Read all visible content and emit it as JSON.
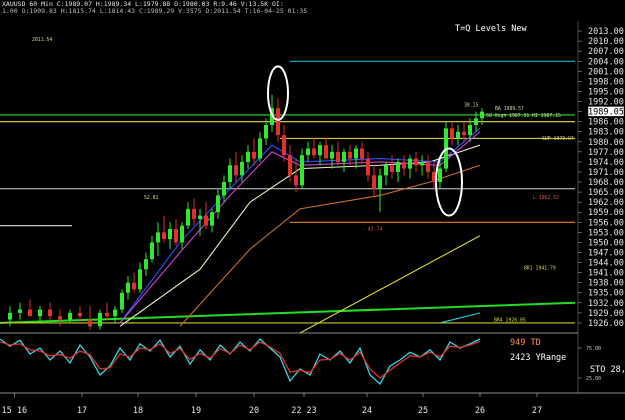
{
  "header": {
    "info_line1": "XAUUSD 60 Min  C:1989.07  H:1989.34  L:1979.88  O:1980.03  R:9.46  V:13.5K  OI:",
    "info_line2": "1.00  O:1909.83  H:1815.74  L:1814.43  C:1989.29  V:3575  D:2011.54  T:16-04-25 01:35",
    "stray_label": "2011.54"
  },
  "chart_data": [
    {
      "type": "candlestick",
      "title": "T=Q Levels New",
      "ylim": [
        1923,
        2016
      ],
      "y_ticks": [
        "2013.00",
        "2010.00",
        "2007.00",
        "2004.00",
        "2001.00",
        "1998.00",
        "1995.00",
        "1992.00",
        "1989.05",
        "1986.00",
        "1983.00",
        "1980.00",
        "1977.00",
        "1974.00",
        "1971.00",
        "1968.00",
        "1965.00",
        "1962.00",
        "1959.00",
        "1956.00",
        "1953.00",
        "1950.00",
        "1947.00",
        "1944.00",
        "1941.00",
        "1938.00",
        "1935.00",
        "1932.00",
        "1929.00",
        "1926.00"
      ],
      "last_price": "1989.05",
      "x_ticks": [
        {
          "label": "15 16",
          "x": 14.3
        },
        {
          "label": "17",
          "x": 82
        },
        {
          "label": "18",
          "x": 138
        },
        {
          "label": "19",
          "x": 196
        },
        {
          "label": "20",
          "x": 254
        },
        {
          "label": "22 23",
          "x": 304
        },
        {
          "label": "24",
          "x": 367
        },
        {
          "label": "25",
          "x": 423
        },
        {
          "label": "26",
          "x": 480
        },
        {
          "label": "27",
          "x": 537
        }
      ],
      "x_domain": [
        0,
        575
      ],
      "candles": [
        [
          10,
          1927,
          1931,
          1925,
          1929
        ],
        [
          20,
          1929,
          1932,
          1927,
          1930
        ],
        [
          30,
          1930,
          1933,
          1928,
          1928
        ],
        [
          40,
          1928,
          1931,
          1926,
          1930
        ],
        [
          50,
          1930,
          1932,
          1927,
          1928
        ],
        [
          60,
          1928,
          1930,
          1925,
          1927
        ],
        [
          70,
          1927,
          1930,
          1926,
          1929
        ],
        [
          80,
          1929,
          1931,
          1926,
          1928
        ],
        [
          90,
          1927,
          1931,
          1924,
          1925
        ],
        [
          100,
          1925,
          1930,
          1924,
          1929
        ],
        [
          107,
          1929,
          1932,
          1927,
          1928
        ],
        [
          115,
          1928,
          1931,
          1926,
          1930
        ],
        [
          122,
          1930,
          1936,
          1929,
          1935
        ],
        [
          128,
          1935,
          1940,
          1933,
          1938
        ],
        [
          134,
          1938,
          1941,
          1935,
          1936
        ],
        [
          140,
          1936,
          1944,
          1935,
          1942
        ],
        [
          146,
          1942,
          1947,
          1940,
          1945
        ],
        [
          152,
          1945,
          1952,
          1944,
          1950
        ],
        [
          158,
          1950,
          1956,
          1946,
          1953
        ],
        [
          164,
          1953,
          1958,
          1950,
          1951
        ],
        [
          170,
          1951,
          1956,
          1948,
          1954
        ],
        [
          176,
          1954,
          1957,
          1949,
          1950
        ],
        [
          182,
          1950,
          1956,
          1948,
          1955
        ],
        [
          188,
          1955,
          1962,
          1954,
          1960
        ],
        [
          194,
          1960,
          1963,
          1955,
          1957
        ],
        [
          200,
          1957,
          1960,
          1952,
          1958
        ],
        [
          206,
          1958,
          1962,
          1954,
          1955
        ],
        [
          212,
          1955,
          1960,
          1953,
          1959
        ],
        [
          218,
          1959,
          1966,
          1957,
          1964
        ],
        [
          224,
          1964,
          1970,
          1962,
          1968
        ],
        [
          230,
          1968,
          1975,
          1966,
          1973
        ],
        [
          236,
          1973,
          1977,
          1968,
          1970
        ],
        [
          242,
          1970,
          1976,
          1968,
          1974
        ],
        [
          248,
          1974,
          1979,
          1972,
          1977
        ],
        [
          254,
          1977,
          1981,
          1973,
          1975
        ],
        [
          260,
          1975,
          1983,
          1974,
          1981
        ],
        [
          266,
          1981,
          1987,
          1979,
          1985
        ],
        [
          272,
          1985,
          1994,
          1983,
          1990
        ],
        [
          278,
          1990,
          1993,
          1980,
          1982
        ],
        [
          284,
          1982,
          1985,
          1974,
          1976
        ],
        [
          290,
          1976,
          1979,
          1968,
          1970
        ],
        [
          296,
          1970,
          1975,
          1965,
          1967
        ],
        [
          302,
          1967,
          1978,
          1966,
          1976
        ],
        [
          308,
          1976,
          1980,
          1974,
          1978
        ],
        [
          314,
          1978,
          1981,
          1975,
          1976
        ],
        [
          320,
          1976,
          1980,
          1973,
          1979
        ],
        [
          326,
          1979,
          1981,
          1975,
          1975
        ],
        [
          332,
          1975,
          1979,
          1972,
          1977
        ],
        [
          338,
          1977,
          1980,
          1973,
          1974
        ],
        [
          344,
          1974,
          1978,
          1971,
          1977
        ],
        [
          350,
          1977,
          1979,
          1973,
          1975
        ],
        [
          356,
          1975,
          1979,
          1972,
          1978
        ],
        [
          362,
          1978,
          1980,
          1974,
          1975
        ],
        [
          368,
          1975,
          1977,
          1968,
          1970
        ],
        [
          374,
          1970,
          1973,
          1964,
          1966
        ],
        [
          380,
          1966,
          1972,
          1959,
          1970
        ],
        [
          386,
          1970,
          1974,
          1967,
          1973
        ],
        [
          392,
          1973,
          1976,
          1969,
          1971
        ],
        [
          398,
          1971,
          1975,
          1968,
          1974
        ],
        [
          404,
          1974,
          1976,
          1970,
          1972
        ],
        [
          410,
          1972,
          1976,
          1969,
          1975
        ],
        [
          416,
          1975,
          1977,
          1971,
          1973
        ],
        [
          422,
          1973,
          1976,
          1970,
          1974
        ],
        [
          428,
          1974,
          1976,
          1969,
          1971
        ],
        [
          434,
          1971,
          1974,
          1966,
          1968
        ],
        [
          440,
          1968,
          1974,
          1966,
          1972
        ],
        [
          446,
          1972,
          1986,
          1971,
          1984
        ],
        [
          452,
          1984,
          1986,
          1979,
          1981
        ],
        [
          458,
          1981,
          1985,
          1979,
          1983
        ],
        [
          464,
          1983,
          1986,
          1980,
          1982
        ],
        [
          470,
          1982,
          1987,
          1980,
          1985
        ],
        [
          476,
          1985,
          1989,
          1983,
          1987
        ],
        [
          482,
          1987,
          1990,
          1985,
          1989
        ]
      ],
      "overlays": [
        {
          "name": "cyan-top-line",
          "color": "#22d4e0",
          "points": [
            [
              290,
              2004
            ],
            [
              575,
              2004
            ]
          ]
        },
        {
          "name": "green-level-upper",
          "color": "#33e033",
          "points": [
            [
              0,
              1988
            ],
            [
              575,
              1988
            ]
          ]
        },
        {
          "name": "yellow-level-upper",
          "color": "#dddd44",
          "points": [
            [
              0,
              1986
            ],
            [
              575,
              1986
            ]
          ]
        },
        {
          "name": "white-level",
          "color": "#cfcfcf",
          "points": [
            [
              0,
              1966
            ],
            [
              575,
              1966
            ]
          ]
        },
        {
          "name": "yellow-level-mid",
          "color": "#d8c840",
          "points": [
            [
              280,
              1981
            ],
            [
              575,
              1981
            ]
          ]
        },
        {
          "name": "orange-level",
          "color": "#e08020",
          "points": [
            [
              290,
              1956
            ],
            [
              575,
              1956
            ]
          ]
        },
        {
          "name": "green-trend",
          "color": "#22dd22",
          "points": [
            [
              0,
              1926
            ],
            [
              575,
              1932
            ]
          ]
        },
        {
          "name": "yellow-lower",
          "color": "#c8c830",
          "points": [
            [
              0,
              1926
            ],
            [
              575,
              1926
            ]
          ]
        },
        {
          "name": "white-segment-left",
          "color": "#e0e0e0",
          "points": [
            [
              0,
              1955
            ],
            [
              72,
              1955
            ]
          ]
        },
        {
          "name": "cyan-lower",
          "color": "#22d4e0",
          "points": [
            [
              440,
              1926
            ],
            [
              480,
              1929
            ]
          ]
        },
        {
          "name": "yellow-diagonal",
          "color": "#d8d830",
          "points": [
            [
              300,
              1923
            ],
            [
              480,
              1952
            ]
          ]
        },
        {
          "name": "ma-white",
          "color": "#f0f0c0",
          "points": [
            [
              120,
              1925
            ],
            [
              200,
              1942
            ],
            [
              250,
              1962
            ],
            [
              300,
              1972
            ],
            [
              380,
              1973
            ],
            [
              430,
              1974
            ],
            [
              480,
              1979
            ]
          ]
        },
        {
          "name": "ma-orange",
          "color": "#d0702a",
          "points": [
            [
              180,
              1925
            ],
            [
              250,
              1948
            ],
            [
              300,
              1960
            ],
            [
              380,
              1964
            ],
            [
              430,
              1968
            ],
            [
              480,
              1973
            ]
          ]
        },
        {
          "name": "ma-blue",
          "color": "#3050ff",
          "points": [
            [
              120,
              1926
            ],
            [
              180,
              1950
            ],
            [
              230,
              1966
            ],
            [
              272,
              1979
            ],
            [
              300,
              1974
            ],
            [
              380,
              1975
            ],
            [
              440,
              1974
            ],
            [
              480,
              1984
            ]
          ]
        },
        {
          "name": "ma-magenta",
          "color": "#d040d0",
          "points": [
            [
              120,
              1926
            ],
            [
              180,
              1947
            ],
            [
              230,
              1964
            ],
            [
              272,
              1977
            ],
            [
              300,
              1973
            ],
            [
              380,
              1974
            ],
            [
              440,
              1973
            ],
            [
              480,
              1983
            ]
          ]
        }
      ],
      "circles": [
        {
          "name": "highlight-circle-top",
          "cx": 278,
          "cy": 1994.5,
          "rx": 10,
          "ry": 5
        },
        {
          "name": "highlight-circle-right",
          "cx": 449,
          "cy": 1968,
          "rx": 13,
          "ry": 7
        }
      ],
      "annotations": [
        {
          "text": "T=Q Levels New",
          "x": 455,
          "y": 2013
        },
        {
          "text": "2011.54",
          "x": 32,
          "y": 2010
        },
        {
          "text": "52.81",
          "x": 144,
          "y": 1963
        },
        {
          "text": "BA 1989.57",
          "x": 495,
          "y": 1989.5
        },
        {
          "text": "SU High 1987.31",
          "x": 486,
          "y": 1987.4
        },
        {
          "text": "HI 1987.15",
          "x": 532,
          "y": 1987.4
        },
        {
          "text": "38.15",
          "x": 464,
          "y": 1990.5
        },
        {
          "text": "SUP 1979.97",
          "x": 542,
          "y": 1980.5
        },
        {
          "text": "L 1962.52",
          "x": 533,
          "y": 1963
        },
        {
          "text": "- 43.74",
          "x": 362,
          "y": 1953.5
        },
        {
          "text": "BR1 1941.79",
          "x": 524,
          "y": 1942
        },
        {
          "text": "BR4 1926.05",
          "x": 494,
          "y": 1926.5
        }
      ]
    },
    {
      "type": "line",
      "title": "STO",
      "ylim": [
        0,
        100
      ],
      "y_ticks": [
        "75.00",
        "25.00"
      ],
      "labels": {
        "td": "949 TD",
        "yrange": "2423 YRange",
        "sto": "STO  28,"
      },
      "series": [
        {
          "name": "k",
          "color": "#33d8e8",
          "x": [
            0,
            10,
            20,
            30,
            40,
            50,
            60,
            70,
            80,
            90,
            100,
            110,
            120,
            130,
            140,
            150,
            160,
            170,
            180,
            190,
            200,
            210,
            220,
            230,
            240,
            250,
            260,
            270,
            280,
            290,
            300,
            310,
            320,
            330,
            340,
            350,
            360,
            370,
            380,
            390,
            400,
            410,
            420,
            430,
            440,
            450,
            460,
            470,
            480
          ],
          "y": [
            90,
            78,
            88,
            65,
            75,
            55,
            70,
            50,
            80,
            60,
            30,
            45,
            75,
            55,
            82,
            70,
            88,
            60,
            78,
            48,
            72,
            55,
            80,
            65,
            85,
            70,
            90,
            75,
            60,
            20,
            40,
            30,
            65,
            55,
            70,
            50,
            75,
            30,
            15,
            45,
            55,
            68,
            60,
            72,
            55,
            85,
            75,
            82,
            90
          ]
        },
        {
          "name": "d",
          "color": "#e03030",
          "x": [
            0,
            10,
            20,
            30,
            40,
            50,
            60,
            70,
            80,
            90,
            100,
            110,
            120,
            130,
            140,
            150,
            160,
            170,
            180,
            190,
            200,
            210,
            220,
            230,
            240,
            250,
            260,
            270,
            280,
            290,
            300,
            310,
            320,
            330,
            340,
            350,
            360,
            370,
            380,
            390,
            400,
            410,
            420,
            430,
            440,
            450,
            460,
            470,
            480
          ],
          "y": [
            85,
            80,
            82,
            72,
            70,
            62,
            64,
            58,
            70,
            64,
            40,
            42,
            65,
            60,
            75,
            72,
            82,
            66,
            74,
            56,
            66,
            58,
            74,
            66,
            80,
            72,
            85,
            77,
            66,
            35,
            38,
            34,
            55,
            56,
            66,
            55,
            68,
            40,
            25,
            38,
            50,
            62,
            60,
            68,
            60,
            78,
            76,
            80,
            86
          ]
        }
      ]
    }
  ]
}
